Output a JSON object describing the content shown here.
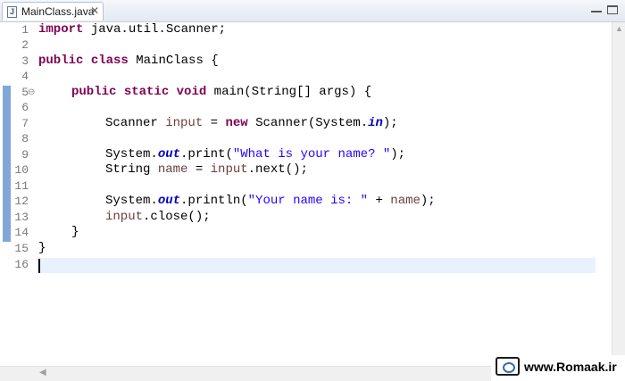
{
  "tab": {
    "file_name": "MainClass.java",
    "file_icon_letter": "J",
    "close_glyph": "✕"
  },
  "line_numbers": [
    "1",
    "2",
    "3",
    "4",
    "5",
    "6",
    "7",
    "8",
    "9",
    "10",
    "11",
    "12",
    "13",
    "14",
    "15",
    "16"
  ],
  "code": {
    "l1_kw": "import",
    "l1_rest": " java.util.Scanner;",
    "l3_kw1": "public",
    "l3_kw2": "class",
    "l3_rest": " MainClass {",
    "l5_kw1": "public",
    "l5_kw2": "static",
    "l5_kw3": "void",
    "l5_rest": " main(String[] args) {",
    "l7_a": "Scanner ",
    "l7_var": "input",
    "l7_b": " = ",
    "l7_kw": "new",
    "l7_c": " Scanner(System.",
    "l7_stat": "in",
    "l7_d": ");",
    "l9_a": "System.",
    "l9_stat": "out",
    "l9_b": ".print(",
    "l9_str": "\"What is your name? \"",
    "l9_c": ");",
    "l10_a": "String ",
    "l10_var": "name",
    "l10_b": " = ",
    "l10_var2": "input",
    "l10_c": ".next();",
    "l12_a": "System.",
    "l12_stat": "out",
    "l12_b": ".println(",
    "l12_str": "\"Your name is: \"",
    "l12_c": " + ",
    "l12_var": "name",
    "l12_d": ");",
    "l13_var": "input",
    "l13_rest": ".close();",
    "l14": "}",
    "l15": "}"
  },
  "watermark": {
    "text": "www.Romaak.ir"
  }
}
